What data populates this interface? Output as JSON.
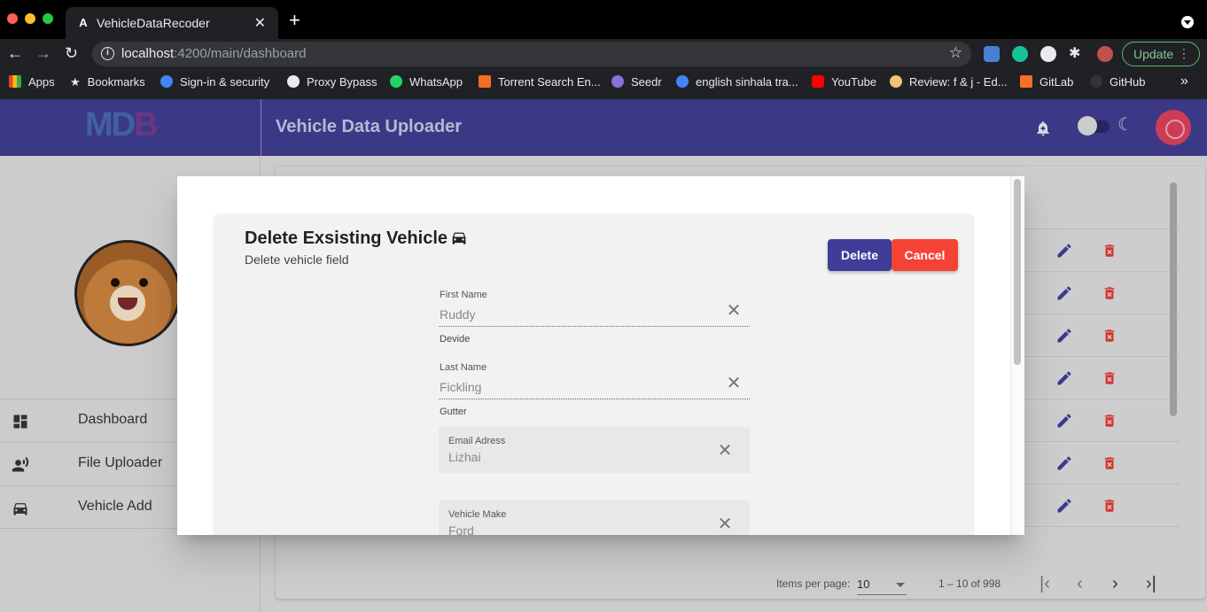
{
  "browser": {
    "tab_title": "VehicleDataRecoder",
    "url_host": "localhost",
    "url_path": ":4200/main/dashboard",
    "update_label": "Update",
    "bookmarks": [
      {
        "label": "Apps",
        "color": "#e94235"
      },
      {
        "label": "Bookmarks",
        "color": "#e8eaed"
      },
      {
        "label": "Sign-in & security",
        "color": "#4285f4"
      },
      {
        "label": "Proxy Bypass",
        "color": "#e8eaed"
      },
      {
        "label": "WhatsApp",
        "color": "#25d366"
      },
      {
        "label": "Torrent Search En...",
        "color": "#f36d21"
      },
      {
        "label": "Seedr",
        "color": "#8a6fd8"
      },
      {
        "label": "english sinhala tra...",
        "color": "#4285f4"
      },
      {
        "label": "YouTube",
        "color": "#ff0000"
      },
      {
        "label": "Review: f & j - Ed...",
        "color": "#f0c27b"
      },
      {
        "label": "GitLab",
        "color": "#fc6d26"
      },
      {
        "label": "GitHub",
        "color": "#333333"
      }
    ],
    "overflow_label": "»"
  },
  "app": {
    "logo": "MD",
    "logo_tail": "B",
    "title": "Vehicle Data Uploader"
  },
  "sidebar": {
    "items": [
      {
        "label": "Dashboard",
        "icon": "dashboard-icon"
      },
      {
        "label": "File Uploader",
        "icon": "record-voice-icon"
      },
      {
        "label": "Vehicle Add",
        "icon": "car-icon"
      }
    ]
  },
  "paginator": {
    "items_per_page_label": "Items per page:",
    "page_size": "10",
    "range": "1 – 10 of 998"
  },
  "dialog": {
    "title": "Delete Exsisting Vehicle",
    "subtitle": "Delete vehicle field",
    "delete_label": "Delete",
    "cancel_label": "Cancel",
    "fields": {
      "first_name": {
        "label": "First Name",
        "value": "Ruddy",
        "hint": "Devide"
      },
      "last_name": {
        "label": "Last Name",
        "value": "Fickling",
        "hint": "Gutter"
      },
      "email": {
        "label": "Email Adress",
        "value": "Lizhai"
      },
      "make": {
        "label": "Vehicle Make",
        "value": "Ford"
      }
    }
  },
  "colors": {
    "primary": "#3f3d99",
    "header": "#3f3d8f",
    "warn": "#f44336",
    "delete_icon": "#e53935"
  }
}
